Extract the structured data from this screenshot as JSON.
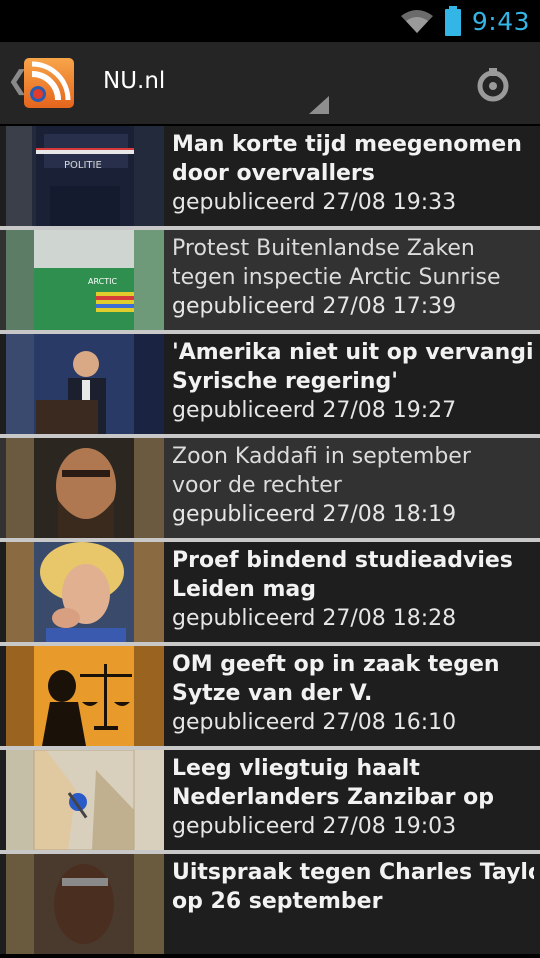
{
  "status": {
    "time": "9:43"
  },
  "actionbar": {
    "title": "NU.nl"
  },
  "articles": [
    {
      "title_line1": "Man korte tijd meegenomen",
      "title_line2": "door overvallers",
      "date": "gepubliceerd 27/08 19:33",
      "read": false,
      "image": "politie-officer"
    },
    {
      "title_line1": "Protest Buitenlandse Zaken",
      "title_line2": "tegen inspectie Arctic Sunrise",
      "date": "gepubliceerd 27/08 17:39",
      "read": true,
      "image": "protest-banner"
    },
    {
      "title_line1": "'Amerika niet uit op vervanging",
      "title_line2": "Syrische regering'",
      "date": "gepubliceerd 27/08 19:27",
      "read": false,
      "image": "press-podium"
    },
    {
      "title_line1": "Zoon Kaddafi in september",
      "title_line2": "voor de rechter",
      "date": "gepubliceerd 27/08 18:19",
      "read": true,
      "image": "portrait-man"
    },
    {
      "title_line1": "Proef bindend studieadvies",
      "title_line2": "Leiden mag",
      "date": "gepubliceerd 27/08 18:28",
      "read": false,
      "image": "portrait-woman"
    },
    {
      "title_line1": "OM geeft op in zaak tegen",
      "title_line2": "Sytze van der V.",
      "date": "gepubliceerd 27/08 16:10",
      "read": false,
      "image": "justice-scales"
    },
    {
      "title_line1": "Leeg vliegtuig haalt",
      "title_line2": "Nederlanders Zanzibar op",
      "date": "gepubliceerd 27/08 19:03",
      "read": false,
      "image": "map-pin"
    },
    {
      "title_line1": "Uitspraak tegen Charles Taylor",
      "title_line2": "op 26 september",
      "date": "",
      "read": false,
      "image": "portrait-man-dark"
    }
  ]
}
